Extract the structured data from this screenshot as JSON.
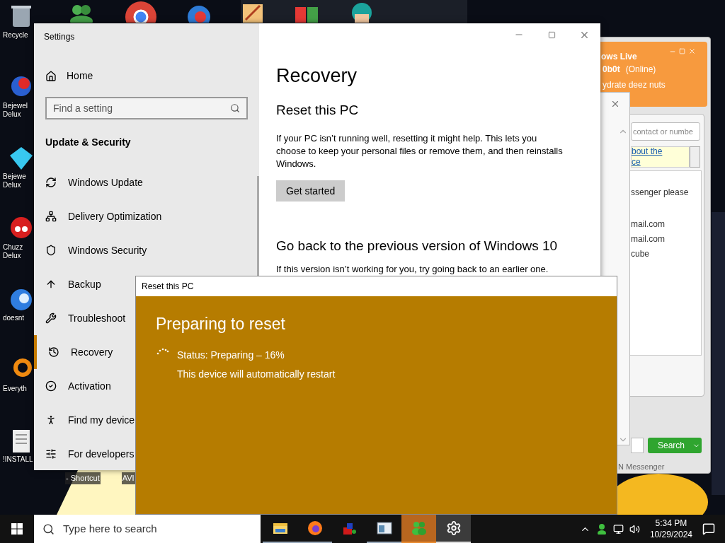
{
  "desktop": {
    "icons": [
      {
        "kind": "recycle",
        "lines": [
          "Recycle"
        ]
      },
      {
        "kind": "gem-two",
        "lines": [
          "Bejewel",
          "Delux"
        ]
      },
      {
        "kind": "gem",
        "lines": [
          "Bejewe",
          "Delux"
        ]
      },
      {
        "kind": "creature",
        "lines": [
          "Chuzz",
          "Delux"
        ]
      },
      {
        "kind": "bird",
        "lines": [
          "doesnt"
        ]
      },
      {
        "kind": "ring",
        "lines": [
          "Everyth"
        ]
      },
      {
        "kind": "document",
        "lines": [
          "!INSTALL"
        ]
      }
    ],
    "bottom_labels": [
      "- Shortcut",
      "AVI"
    ]
  },
  "messenger": {
    "title": "ows Live",
    "name": "0b0t",
    "status": "(Online)",
    "personal_message": "ydrate deez nuts",
    "search_placeholder": "contact or numbe",
    "notice_lines": [
      "bout the",
      "ce"
    ],
    "list_lines": [
      "ssenger please",
      "mail.com",
      "mail.com",
      "cube"
    ],
    "search_button": "Search",
    "footer": "N Messenger"
  },
  "settings": {
    "title": "Settings",
    "home": "Home",
    "search_placeholder": "Find a setting",
    "section": "Update & Security",
    "items": [
      {
        "kind": "update",
        "label": "Windows Update",
        "selected": false
      },
      {
        "kind": "delivery",
        "label": "Delivery Optimization",
        "selected": false
      },
      {
        "kind": "shield",
        "label": "Windows Security",
        "selected": false
      },
      {
        "kind": "backup",
        "label": "Backup",
        "selected": false
      },
      {
        "kind": "wrench",
        "label": "Troubleshoot",
        "selected": false
      },
      {
        "kind": "recovery",
        "label": "Recovery",
        "selected": true
      },
      {
        "kind": "activation",
        "label": "Activation",
        "selected": false
      },
      {
        "kind": "find",
        "label": "Find my device",
        "selected": false
      },
      {
        "kind": "developer",
        "label": "For developers",
        "selected": false
      }
    ],
    "page_title": "Recovery",
    "reset_heading": "Reset this PC",
    "reset_text": "If your PC isn’t running well, resetting it might help. This lets you choose to keep your personal files or remove them, and then reinstalls Windows.",
    "reset_button": "Get started",
    "goback_heading": "Go back to the previous version of Windows 10",
    "goback_text": "If this version isn’t working for you, try going back to an earlier one."
  },
  "dialog": {
    "title": "Reset this PC",
    "heading": "Preparing to reset",
    "status": "Status: Preparing – 16%",
    "note": "This device will automatically restart"
  },
  "taskbar": {
    "search_placeholder": "Type here to search",
    "apps": [
      {
        "kind": "folder",
        "open": true,
        "attention": false,
        "selected": false
      },
      {
        "kind": "firefox",
        "open": true,
        "attention": false,
        "selected": false
      },
      {
        "kind": "game",
        "open": false,
        "attention": false,
        "selected": false
      },
      {
        "kind": "window",
        "open": true,
        "attention": false,
        "selected": false
      },
      {
        "kind": "messenger",
        "open": true,
        "attention": true,
        "selected": false
      },
      {
        "kind": "settings",
        "open": true,
        "attention": false,
        "selected": true
      }
    ],
    "time": "5:34 PM",
    "date": "10/29/2024"
  }
}
